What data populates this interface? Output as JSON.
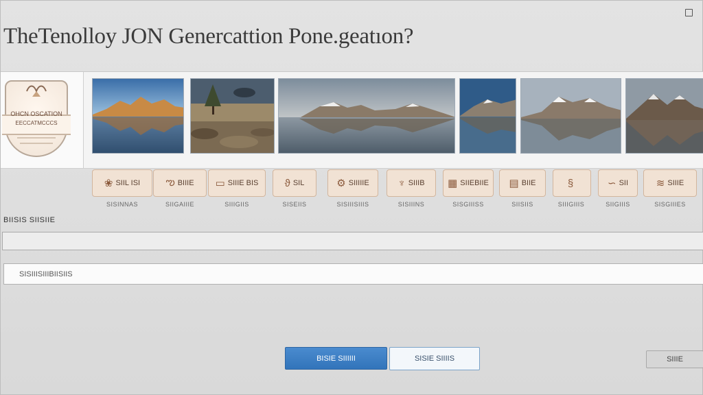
{
  "window": {
    "caption": "",
    "maximize_icon": "maximize-icon"
  },
  "header": {
    "title": "TheTenolloy JON Genercattion Pone.geatıon?"
  },
  "crest": {
    "line1": "OHCN OSCATION",
    "line2": "EECCATMCCCS"
  },
  "gallery": {
    "images": [
      {
        "name": "lake-mountain-sunset"
      },
      {
        "name": "tree-rocky-shore"
      },
      {
        "name": "mountain-lake-reflection-panorama"
      },
      {
        "name": "blue-lake-mountains"
      },
      {
        "name": "snowy-peak-reflection"
      },
      {
        "name": "alpine-peaks-reflection"
      }
    ]
  },
  "features": [
    {
      "icon": "flower-icon",
      "glyph": "❀",
      "label": "SIIL ISI",
      "caption": "SISINNAS"
    },
    {
      "icon": "dragon-icon",
      "glyph": "ఌ",
      "label": "BIIIE",
      "caption": "SIIGAIIIE"
    },
    {
      "icon": "chart-icon",
      "glyph": "▭",
      "label": "SIIIE BIS",
      "caption": "SIIIGIIS"
    },
    {
      "icon": "bird-icon",
      "glyph": "ϑ",
      "label": "SIL",
      "caption": "SISEIIS"
    },
    {
      "icon": "gear-icon",
      "glyph": "⚙",
      "label": "SIIIIIE",
      "caption": "SISIIISIIIS"
    },
    {
      "icon": "glyph-icon",
      "glyph": "♆",
      "label": "SIIIB",
      "caption": "SISIIINS"
    },
    {
      "icon": "document-icon",
      "glyph": "▦",
      "label": "SIIEBIIE",
      "caption": "SISGIIISS"
    },
    {
      "icon": "table-icon",
      "glyph": "▤",
      "label": "BIIE",
      "caption": "SIISIIS"
    },
    {
      "icon": "figure-icon",
      "glyph": "§",
      "label": "",
      "caption": "SIIIGIIIS"
    },
    {
      "icon": "swirl-icon",
      "glyph": "∽",
      "label": "SII",
      "caption": "SIIGIIIS"
    },
    {
      "icon": "sign-icon",
      "glyph": "≋",
      "label": "SIIIE",
      "caption": "SISGIIIES"
    }
  ],
  "form": {
    "label": "BIISIS SIISIIE",
    "field2_value": "SISIIISIIIBIISIIS"
  },
  "buttons": {
    "primary": "BISIE SIIIIII",
    "secondary": "SISIE SIIIIS",
    "tertiary": "SIIIE"
  }
}
